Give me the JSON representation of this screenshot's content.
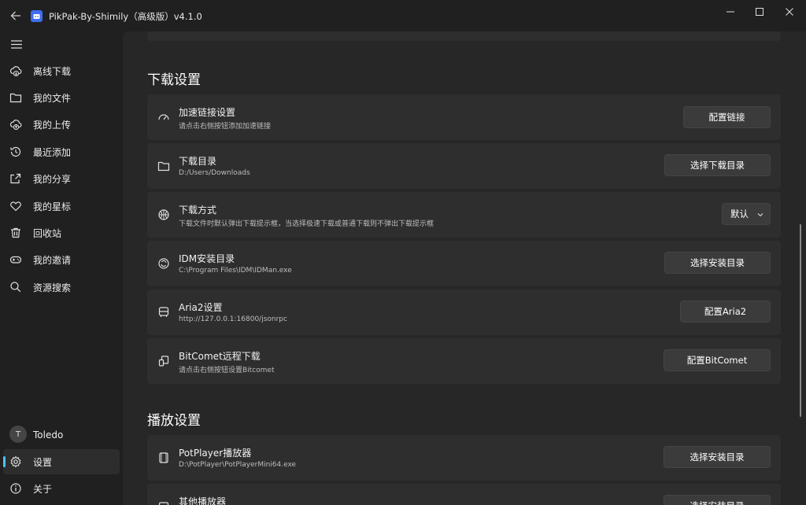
{
  "window": {
    "title": "PikPak-By-Shimily（高级版）v4.1.0"
  },
  "sidebar": {
    "items": [
      {
        "label": "离线下载",
        "icon": "cloud-download-icon"
      },
      {
        "label": "我的文件",
        "icon": "folder-icon"
      },
      {
        "label": "我的上传",
        "icon": "cloud-upload-icon"
      },
      {
        "label": "最近添加",
        "icon": "history-icon"
      },
      {
        "label": "我的分享",
        "icon": "share-icon"
      },
      {
        "label": "我的星标",
        "icon": "heart-icon"
      },
      {
        "label": "回收站",
        "icon": "trash-icon"
      },
      {
        "label": "我的邀请",
        "icon": "gamepad-icon"
      },
      {
        "label": "资源搜索",
        "icon": "search-icon"
      }
    ],
    "user": {
      "initial": "T",
      "name": "Toledo"
    },
    "settings_label": "设置",
    "about_label": "关于"
  },
  "download_section": {
    "title": "下载设置",
    "cards": [
      {
        "title": "加速链接设置",
        "subtitle": "请点击右侧按钮添加加速链接",
        "button": "配置链接",
        "icon": "speedometer-icon"
      },
      {
        "title": "下载目录",
        "subtitle": "D:/Users/Downloads",
        "button": "选择下载目录",
        "icon": "folder-icon"
      },
      {
        "title": "下载方式",
        "subtitle": "下载文件时默认弹出下载提示框，当选择极速下载或普通下载则不弹出下载提示框",
        "dropdown": "默认",
        "icon": "basketball-icon"
      },
      {
        "title": "IDM安装目录",
        "subtitle": "C:\\Program Files\\IDM\\IDMan.exe",
        "button": "选择安装目录",
        "icon": "refresh-circle-icon"
      },
      {
        "title": "Aria2设置",
        "subtitle": "http://127.0.0.1:16800/jsonrpc",
        "button": "配置Aria2",
        "icon": "bus-icon"
      },
      {
        "title": "BitComet远程下载",
        "subtitle": "请点击右侧按钮设置Bitcomet",
        "button": "配置BitComet",
        "icon": "devices-icon"
      }
    ]
  },
  "play_section": {
    "title": "播放设置",
    "cards": [
      {
        "title": "PotPlayer播放器",
        "subtitle": "D:\\PotPlayer\\PotPlayerMini64.exe",
        "button": "选择安装目录",
        "icon": "film-icon"
      },
      {
        "title": "其他播放器",
        "button": "选择安装目录",
        "icon": "player-icon"
      }
    ]
  }
}
